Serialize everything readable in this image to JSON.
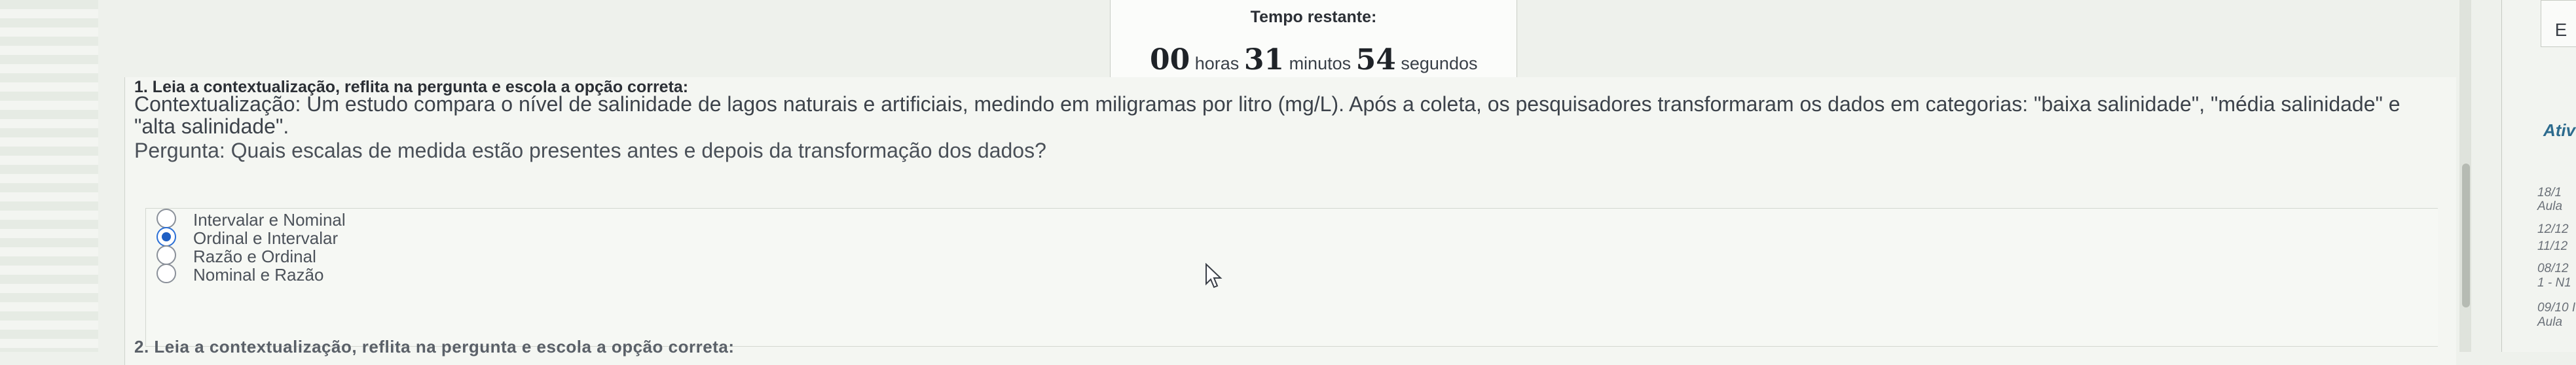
{
  "timer": {
    "title": "Tempo restante:",
    "hours": "00",
    "hours_label": "horas",
    "minutes": "31",
    "minutes_label": "minutos",
    "seconds": "54",
    "seconds_label": "segundos"
  },
  "question": {
    "heading": "1. Leia a contextualização, reflita na pergunta e escola a opção correta:",
    "context": "Contextualização: Um estudo compara o nível de salinidade de lagos naturais e artificiais, medindo em miligramas por litro (mg/L). Após a coleta, os pesquisadores transformaram os dados em categorias: \"baixa salinidade\", \"média salinidade\" e \"alta salinidade\".",
    "prompt": "Pergunta: Quais escalas de medida estão presentes antes e depois da transformação dos dados?",
    "options": [
      {
        "label": "Intervalar e Nominal",
        "selected": false
      },
      {
        "label": "Ordinal e Intervalar",
        "selected": true
      },
      {
        "label": "Razão e Ordinal",
        "selected": false
      },
      {
        "label": "Nominal e Razão",
        "selected": false
      }
    ]
  },
  "next_question_heading": "2. Leia a contextualização, reflita na pergunta e escola a opção correta:",
  "side": {
    "top_button": "E",
    "title": "Ativ",
    "items": [
      "18/1",
      "Aula",
      "12/12",
      "11/12",
      "08/12",
      "1 - N1",
      "09/10 I",
      "Aula"
    ]
  },
  "colors": {
    "radio_selected": "#1f5fc4",
    "side_title": "#2d6b8e"
  }
}
